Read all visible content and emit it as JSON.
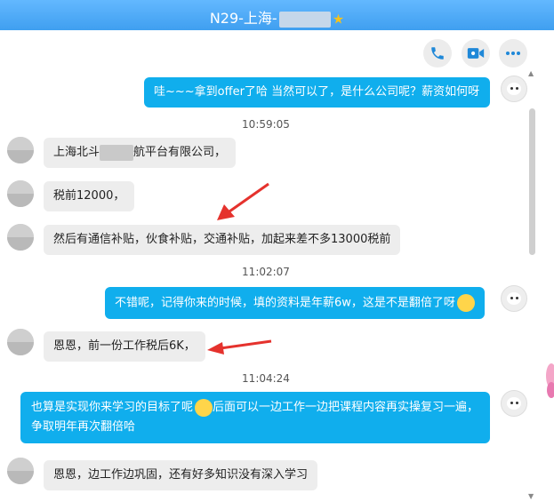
{
  "window": {
    "title_prefix": "N29-上海-",
    "title_suffix": ""
  },
  "toolbar": {
    "icons": [
      "phone-icon",
      "video-call-icon",
      "more-icon"
    ]
  },
  "messages": [
    {
      "from": "me",
      "text": "哇~~~拿到offer了哈  当然可以了，是什么公司呢？薪资如何呀"
    },
    {
      "type": "timestamp",
      "text": "10:59:05"
    },
    {
      "from": "contact",
      "text_before": "上海北斗",
      "text_after": "航平台有限公司，"
    },
    {
      "from": "contact",
      "text": "税前12000，"
    },
    {
      "from": "contact",
      "text": "然后有通信补贴，伙食补贴，交通补贴，加起来差不多13000税前"
    },
    {
      "type": "timestamp",
      "text": "11:02:07"
    },
    {
      "from": "me",
      "text": "不错呢，记得你来的时候，填的资料是年薪6w，这是不是翻倍了呀"
    },
    {
      "from": "contact",
      "text": "恩恩，前一份工作税后6K，"
    },
    {
      "type": "timestamp",
      "text": "11:04:24"
    },
    {
      "from": "me",
      "text_before": "也算是实现你来学习的目标了呢",
      "text_after": "后面可以一边工作一边把课程内容再实操复习一遍，争取明年再次翻倍哈"
    },
    {
      "from": "contact",
      "text": "恩恩，边工作边巩固，还有好多知识没有深入学习"
    }
  ],
  "colors": {
    "titlebar": "#4aa8f5",
    "outgoing_bubble": "#10aeed",
    "incoming_bubble": "#ededed",
    "annotation_arrow": "#e5322d"
  }
}
